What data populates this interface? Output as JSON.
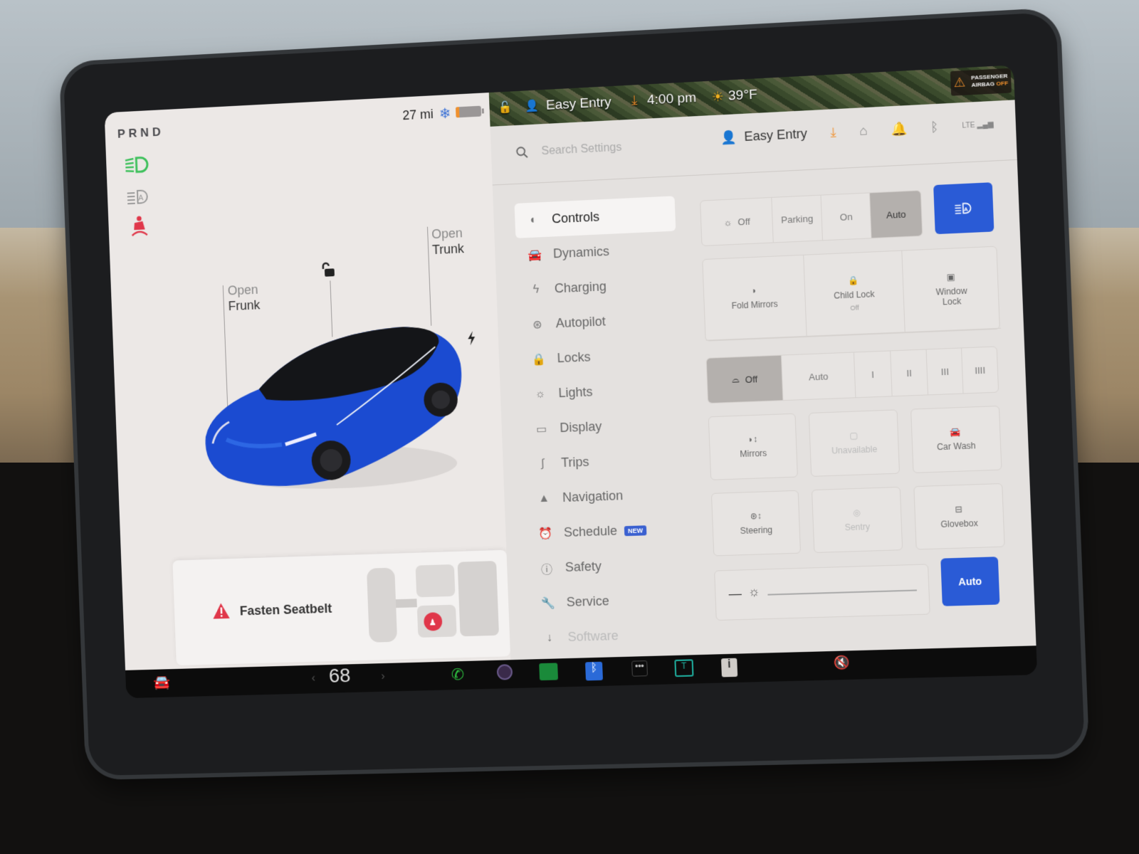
{
  "status": {
    "gear": "PRND",
    "range": "27 mi",
    "snow_icon": "snowflake-icon",
    "battery_level": 0.1
  },
  "car_panel": {
    "frunk": {
      "action": "Open",
      "target": "Frunk"
    },
    "trunk": {
      "action": "Open",
      "target": "Trunk"
    },
    "lock_icon": "unlocked-icon",
    "charge_icon": "lightning-icon",
    "alert": {
      "icon": "warning-icon",
      "text": "Fasten Seatbelt"
    }
  },
  "map_strip": {
    "profile": "Easy Entry",
    "time": "4:00 pm",
    "temperature": "39°F",
    "airbag": {
      "line1": "PASSENGER",
      "line2a": "AIRBAG ",
      "line2b": "OFF"
    }
  },
  "header": {
    "search_placeholder": "Search Settings",
    "profile": "Easy Entry",
    "icons": [
      "download-icon",
      "garage-icon",
      "bell-icon",
      "bluetooth-icon",
      "lte-signal-icon"
    ],
    "lte": "LTE"
  },
  "nav": {
    "items": [
      {
        "label": "Controls",
        "icon": "toggle-icon",
        "active": true
      },
      {
        "label": "Dynamics",
        "icon": "car-icon"
      },
      {
        "label": "Charging",
        "icon": "lightning-icon"
      },
      {
        "label": "Autopilot",
        "icon": "steering-wheel-icon"
      },
      {
        "label": "Locks",
        "icon": "lock-icon"
      },
      {
        "label": "Lights",
        "icon": "sun-icon"
      },
      {
        "label": "Display",
        "icon": "display-icon"
      },
      {
        "label": "Trips",
        "icon": "trips-icon"
      },
      {
        "label": "Navigation",
        "icon": "navigation-arrow-icon"
      },
      {
        "label": "Schedule",
        "icon": "alarm-clock-icon",
        "badge": "NEW"
      },
      {
        "label": "Safety",
        "icon": "alert-circle-icon"
      },
      {
        "label": "Service",
        "icon": "wrench-icon"
      },
      {
        "label": "Software",
        "icon": "download-arrow-icon"
      }
    ]
  },
  "controls": {
    "lights": {
      "options": [
        "Off",
        "Parking",
        "On",
        "Auto"
      ],
      "selected": "Auto"
    },
    "auto_high_beam_icon": "auto-headlight-icon",
    "tiles_row1": [
      {
        "label": "Fold Mirrors",
        "icon": "mirror-icon"
      },
      {
        "label": "Child Lock",
        "sub": "Off",
        "icon": "child-lock-icon"
      },
      {
        "label": "Window\nLock",
        "icon": "window-lock-icon"
      }
    ],
    "wipers": {
      "options": [
        "Off",
        "Auto",
        "I",
        "II",
        "III",
        "IIII"
      ],
      "selected": "Off"
    },
    "tiles_grid": [
      {
        "label": "Mirrors",
        "icon": "mirror-adjust-icon"
      },
      {
        "label": "Unavailable",
        "icon": "dashcam-icon",
        "disabled": true
      },
      {
        "label": "Car Wash",
        "icon": "car-wash-icon"
      },
      {
        "label": "Steering",
        "icon": "steering-adjust-icon"
      },
      {
        "label": "Sentry",
        "icon": "sentry-icon",
        "disabled": true
      },
      {
        "label": "Glovebox",
        "icon": "glovebox-icon"
      }
    ],
    "brightness_icon": "brightness-icon",
    "brightness_auto": "Auto"
  },
  "dock": {
    "temperature": "68",
    "apps": [
      "phone-icon",
      "camera-icon",
      "energy-icon",
      "bluetooth-icon",
      "more-icon",
      "toybox-icon",
      "info-icon"
    ],
    "volume_icon": "mute-icon"
  }
}
